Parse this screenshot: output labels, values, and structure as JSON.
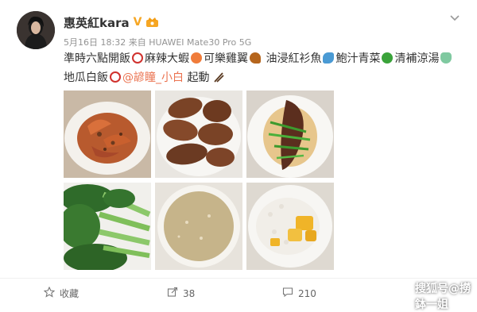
{
  "post": {
    "username": "惠英紅kara",
    "verified_badge": "V",
    "date": "5月16日 18:32",
    "source": "来自 HUAWEI Mate30 Pro 5G",
    "content": {
      "line1_parts": [
        "準時六點開飯",
        "麻辣大蝦",
        "可樂雞翼",
        "油浸紅衫魚",
        "鮑汁青菜",
        "清補涼湯"
      ],
      "line2_prefix": "地瓜白飯",
      "mention": "@諺瞳_小白",
      "line2_suffix": "起動"
    }
  },
  "photos": [
    {
      "name": "麻辣大蝦"
    },
    {
      "name": "可樂雞翼"
    },
    {
      "name": "油浸紅衫魚"
    },
    {
      "name": "鮑汁青菜"
    },
    {
      "name": "清補涼湯"
    },
    {
      "name": "地瓜白飯"
    }
  ],
  "footer": {
    "favorite_label": "收藏",
    "share_count": "38",
    "like_count": "210"
  },
  "watermark": "搜狐号@撈鉢一姐",
  "colors": {
    "accent": "#eb7350",
    "text": "#333333",
    "meta": "#939393",
    "gold": "#f6a623"
  }
}
